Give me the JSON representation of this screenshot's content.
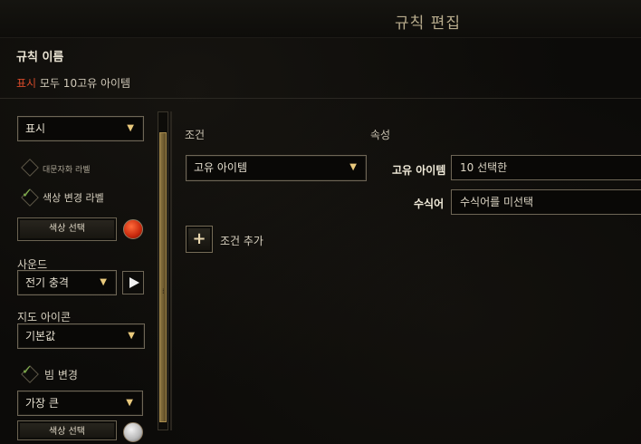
{
  "header": {
    "title": "규칙 편집"
  },
  "rule": {
    "name_label": "규칙 이름",
    "summary_accent": "표시",
    "summary_rest": " 모두 10고유 아이템"
  },
  "left_panel": {
    "display_dropdown": "표시",
    "unknown_label": "대문자화 라벨",
    "color_change_label": "색상 변경 라벨",
    "color_select_button": "색상 선택",
    "sound_label": "사운드",
    "sound_dropdown": "전기 충격",
    "map_icon_label": "지도 아이콘",
    "map_icon_dropdown": "기본값",
    "beam_change_label": "빔 변경",
    "beam_dropdown": "가장 큰",
    "beam_color_button": "색상 선택",
    "accent_color": "#d44a2a",
    "beam_swatch_color": "#d9d9d9"
  },
  "conditions": {
    "section_label": "조건",
    "condition_dropdown": "고유 아이템",
    "add_condition_label": "조건 추가"
  },
  "properties": {
    "section_label": "속성",
    "unique_item_label": "고유 아이템",
    "unique_item_value": "10 선택한",
    "modifier_label": "수식어",
    "modifier_value": "수식어를 미선택"
  }
}
